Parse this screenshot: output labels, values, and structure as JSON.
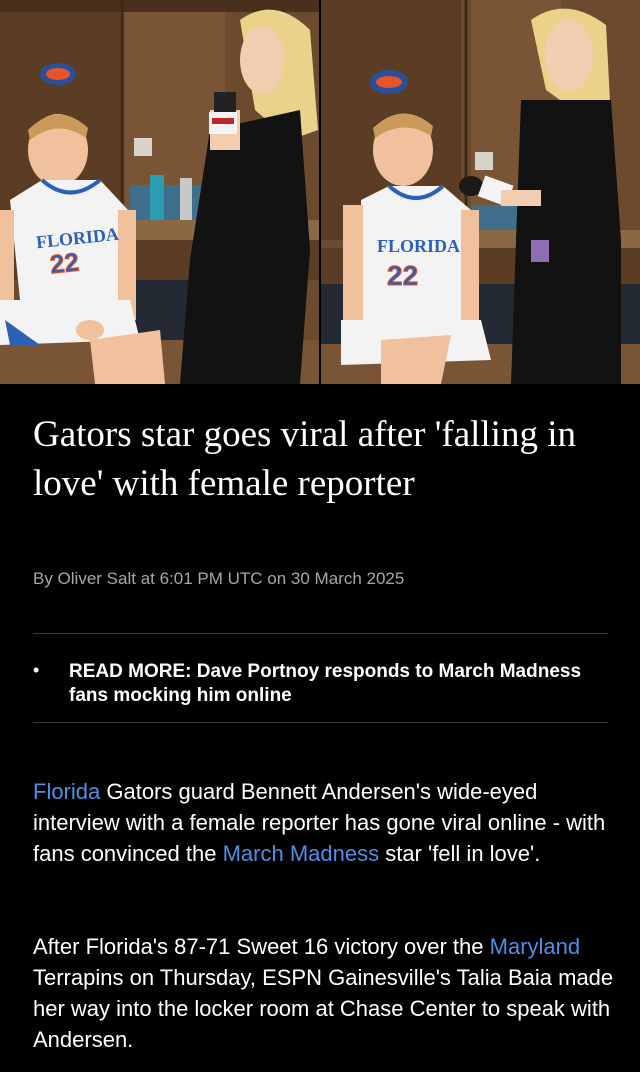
{
  "photos": [
    {
      "jersey_team": "FLORIDA",
      "jersey_number": "22"
    },
    {
      "jersey_team": "FLORIDA",
      "jersey_number": "22"
    }
  ],
  "article": {
    "headline": "Gators star goes viral after 'falling in love' with female reporter",
    "byline": "By Oliver Salt at 6:01 PM UTC on 30 March 2025",
    "read_more": {
      "bullet": "•",
      "label": "READ MORE: Dave Portnoy responds to March Madness fans mocking him online"
    },
    "paragraph1": {
      "link1": "Florida",
      "text1": " Gators guard Bennett Andersen's wide-eyed interview with a female reporter has gone viral online - with fans convinced the ",
      "link2": "March Madness",
      "text2": " star 'fell in love'."
    },
    "paragraph2": {
      "text1": "After Florida's 87-71 Sweet 16 victory over the ",
      "link1": "Maryland",
      "text2": " Terrapins on Thursday, ESPN Gainesville's Talia Baia made her way into the locker room at Chase Center to speak with Andersen."
    }
  },
  "colors": {
    "background": "#000000",
    "link": "#4f8fe6",
    "byline": "#a7a7a7",
    "jersey_blue": "#2b5fb8",
    "jersey_orange": "#e8542a"
  }
}
